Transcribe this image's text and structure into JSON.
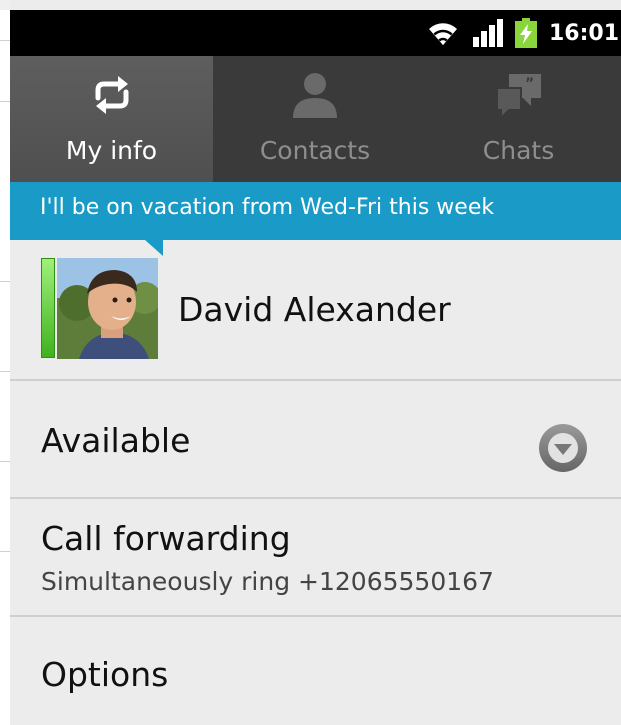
{
  "status_bar": {
    "time": "16:01",
    "icons": [
      "wifi-icon",
      "signal-icon",
      "battery-charging-icon"
    ]
  },
  "tabs": [
    {
      "label": "My info",
      "icon": "refresh-arrows-icon",
      "active": true
    },
    {
      "label": "Contacts",
      "icon": "person-icon",
      "active": false
    },
    {
      "label": "Chats",
      "icon": "chat-bubbles-icon",
      "active": false
    }
  ],
  "banner": {
    "message": "I'll be on vacation from Wed-Fri this week"
  },
  "profile": {
    "name": "David Alexander",
    "presence_color": "#4cc21f"
  },
  "status": {
    "label": "Available"
  },
  "call_forwarding": {
    "title": "Call forwarding",
    "detail": "Simultaneously ring +12065550167"
  },
  "options": {
    "label": "Options"
  },
  "colors": {
    "accent": "#1a9bc7",
    "tab_bar": "#3a3a3a",
    "tab_active": "#555555",
    "background": "#ececec"
  }
}
